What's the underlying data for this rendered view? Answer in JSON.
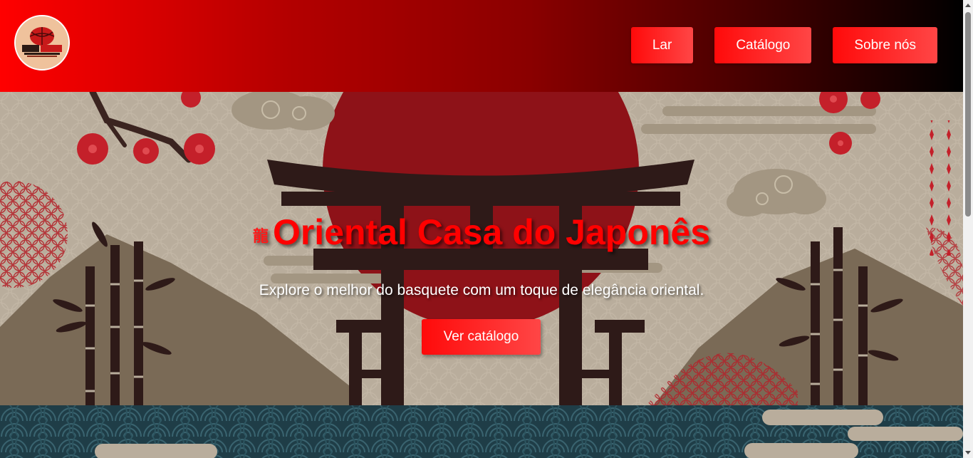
{
  "header": {
    "logo_alt": "Casa do Japonês",
    "nav": {
      "home_label": "Lar",
      "catalog_label": "Catálogo",
      "about_label": "Sobre nós"
    }
  },
  "hero": {
    "kanji": "龍",
    "title": "Oriental Casa do Japonês",
    "subtitle": "Explore o melhor do basquete com um toque de elegância oriental.",
    "cta_label": "Ver catálogo"
  },
  "colors": {
    "brand_red": "#ff0000",
    "button_gradient_start": "#ff0a0a",
    "button_gradient_end": "#ff4646",
    "hero_sun": "#8e1218",
    "torii_dark": "#2e1a18",
    "hero_beige": "#b9ad9c",
    "wave_teal": "#1f3d47"
  },
  "icons": {
    "logo": "basketball-logo-icon",
    "scroll_up": "scroll-up-arrow-icon",
    "scroll_down": "scroll-down-arrow-icon"
  }
}
